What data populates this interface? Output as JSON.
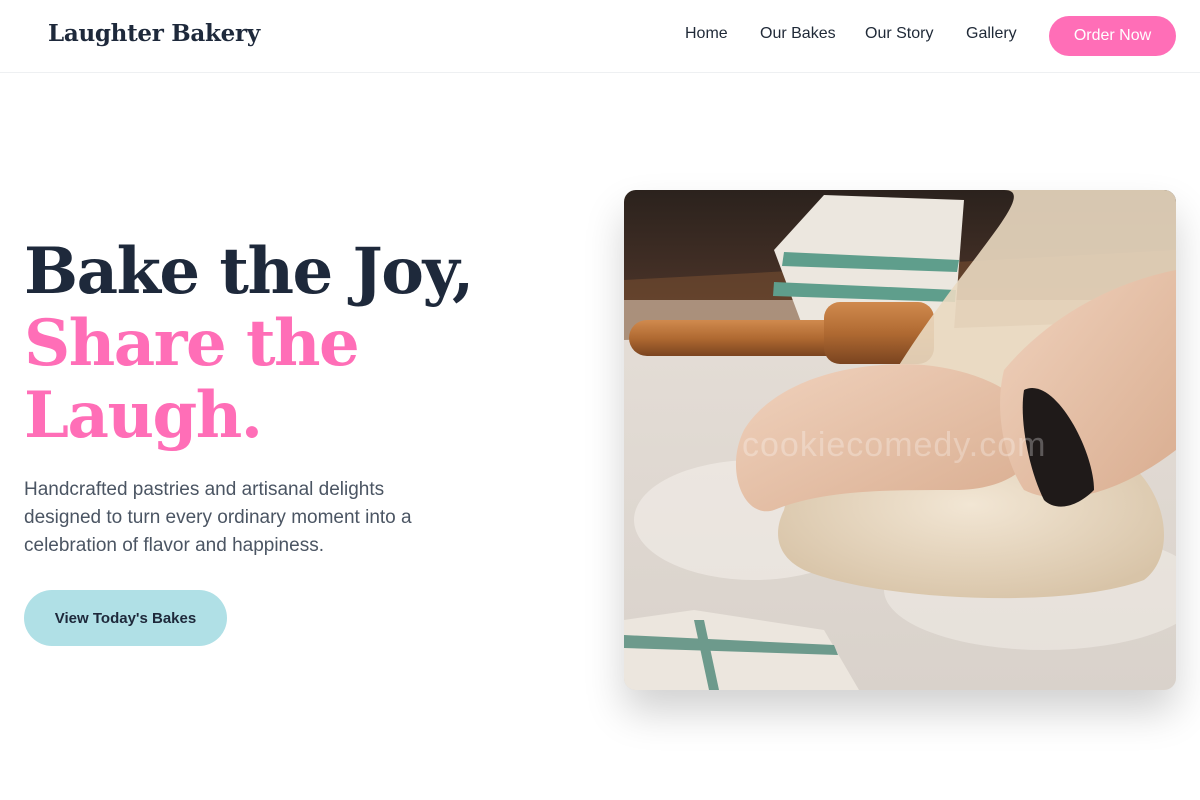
{
  "brand": {
    "name": "Laughter Bakery",
    "accent_color": "#ff6eb7",
    "secondary_color": "#b0e0e6"
  },
  "nav": {
    "links": [
      {
        "label": "Home"
      },
      {
        "label": "Our Bakes"
      },
      {
        "label": "Our Story"
      },
      {
        "label": "Gallery"
      }
    ],
    "cta_label": "Order Now"
  },
  "hero": {
    "title_line1": "Bake the Joy,",
    "title_accent": "Share the Laugh.",
    "subtitle": "Handcrafted pastries and artisanal delights designed to turn every ordinary moment into a celebration of flavor and happiness.",
    "cta_label": "View Today's Bakes",
    "image": {
      "subject": "hands kneading dough with rolling pin and striped towel",
      "watermark": "cookiecomedy.com"
    }
  }
}
